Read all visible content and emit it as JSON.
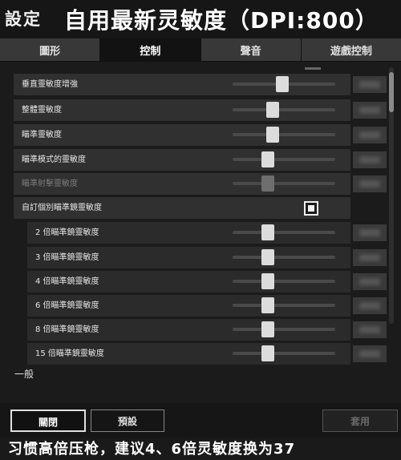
{
  "header": {
    "settings_label": "設定",
    "overlay_title": "自用最新灵敏度（DPI:800）"
  },
  "tabs": [
    {
      "label": "圖形"
    },
    {
      "label": "控制"
    },
    {
      "label": "聲音"
    },
    {
      "label": "遊戲控制"
    }
  ],
  "active_tab": "控制",
  "settings": [
    {
      "label": "垂直靈敏度增強",
      "level": 0.42,
      "enabled": true
    },
    {
      "label": "整體靈敏度",
      "level": 0.33,
      "enabled": true
    },
    {
      "label": "瞄準靈敏度",
      "level": 0.33,
      "enabled": true
    },
    {
      "label": "瞄準模式的靈敏度",
      "level": 0.28,
      "enabled": true
    },
    {
      "label": "瞄準射擊靈敏度",
      "level": 0.28,
      "enabled": false
    }
  ],
  "custom_scope": {
    "label": "自訂個別瞄準鏡靈敏度",
    "checked": true
  },
  "scopes": [
    {
      "label": "2 倍瞄準鏡靈敏度",
      "level": 0.28
    },
    {
      "label": "3 倍瞄準鏡靈敏度",
      "level": 0.28
    },
    {
      "label": "4 倍瞄準鏡靈敏度",
      "level": 0.28
    },
    {
      "label": "6 倍瞄準鏡靈敏度",
      "level": 0.28
    },
    {
      "label": "8 倍瞄準鏡靈敏度",
      "level": 0.28
    },
    {
      "label": "15 倍瞄準鏡靈敏度",
      "level": 0.28
    }
  ],
  "section": {
    "general_label": "一般"
  },
  "buttons": {
    "close": "關閉",
    "preset": "預設",
    "apply": "套用"
  },
  "caption": "习惯高倍压枪，建议4、6倍灵敏度换为37",
  "colors": {
    "background": "#1b1b1b",
    "active_tab": "#121212",
    "slider_thumb": "#dcdcdc"
  }
}
